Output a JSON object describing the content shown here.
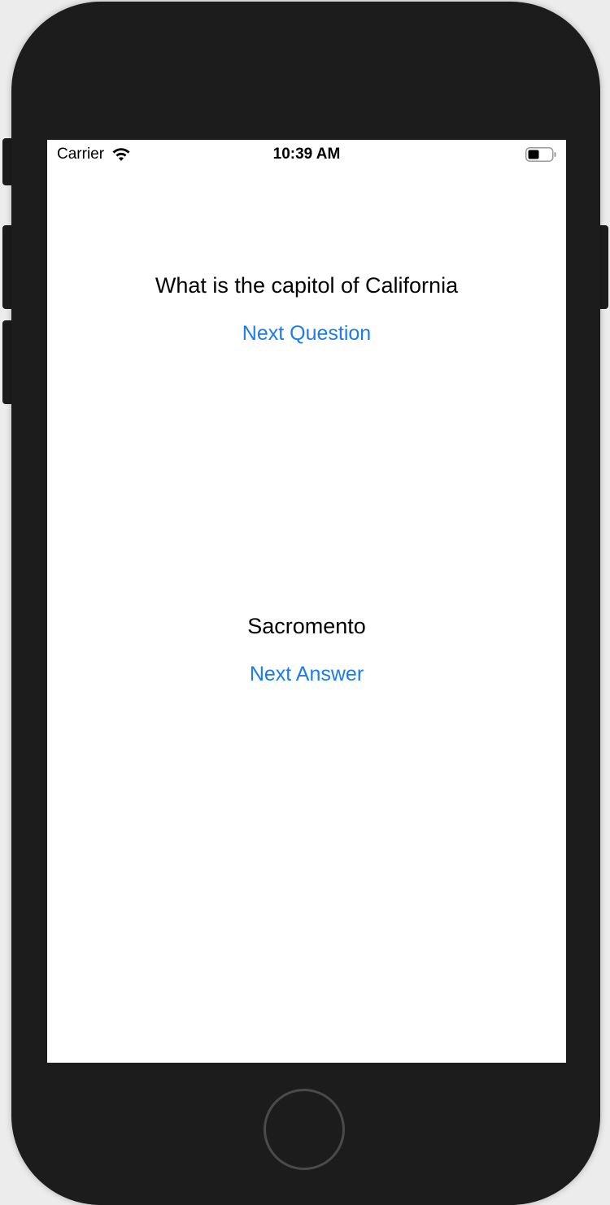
{
  "status_bar": {
    "carrier": "Carrier",
    "time": "10:39 AM",
    "icons": [
      "wifi-icon",
      "battery-icon"
    ]
  },
  "quiz": {
    "question": "What is the capitol of California",
    "next_question_label": "Next Question",
    "answer": "Sacromento",
    "next_answer_label": "Next Answer"
  },
  "colors": {
    "accent": "#1a7cf0",
    "device_body": "#1c1c1c",
    "screen_bg": "#ffffff"
  }
}
